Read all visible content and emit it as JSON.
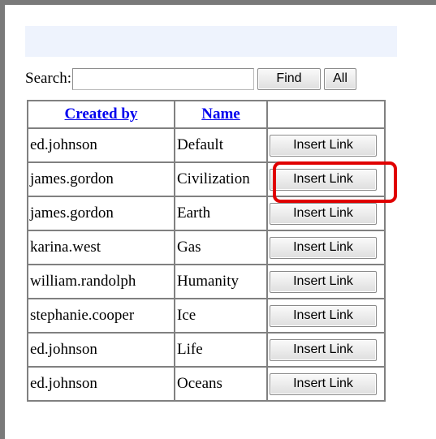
{
  "search": {
    "label": "Search:",
    "value": "",
    "placeholder": "",
    "find_label": "Find",
    "all_label": "All"
  },
  "table": {
    "headers": {
      "created_by": "Created by",
      "name": "Name",
      "action": ""
    },
    "rows": [
      {
        "created_by": "ed.johnson",
        "name": "Default",
        "action": "Insert Link"
      },
      {
        "created_by": "james.gordon",
        "name": "Civilization",
        "action": "Insert Link"
      },
      {
        "created_by": "james.gordon",
        "name": "Earth",
        "action": "Insert Link"
      },
      {
        "created_by": "karina.west",
        "name": "Gas",
        "action": "Insert Link"
      },
      {
        "created_by": "william.randolph",
        "name": "Humanity",
        "action": "Insert Link"
      },
      {
        "created_by": "stephanie.cooper",
        "name": "Ice",
        "action": "Insert Link"
      },
      {
        "created_by": "ed.johnson",
        "name": "Life",
        "action": "Insert Link"
      },
      {
        "created_by": "ed.johnson",
        "name": "Oceans",
        "action": "Insert Link"
      }
    ]
  },
  "highlight": {
    "row_index": 1,
    "color": "#e00000"
  },
  "colors": {
    "banner": "#eef3fd",
    "link": "#0000ee",
    "frame": "#7a7a7a"
  }
}
